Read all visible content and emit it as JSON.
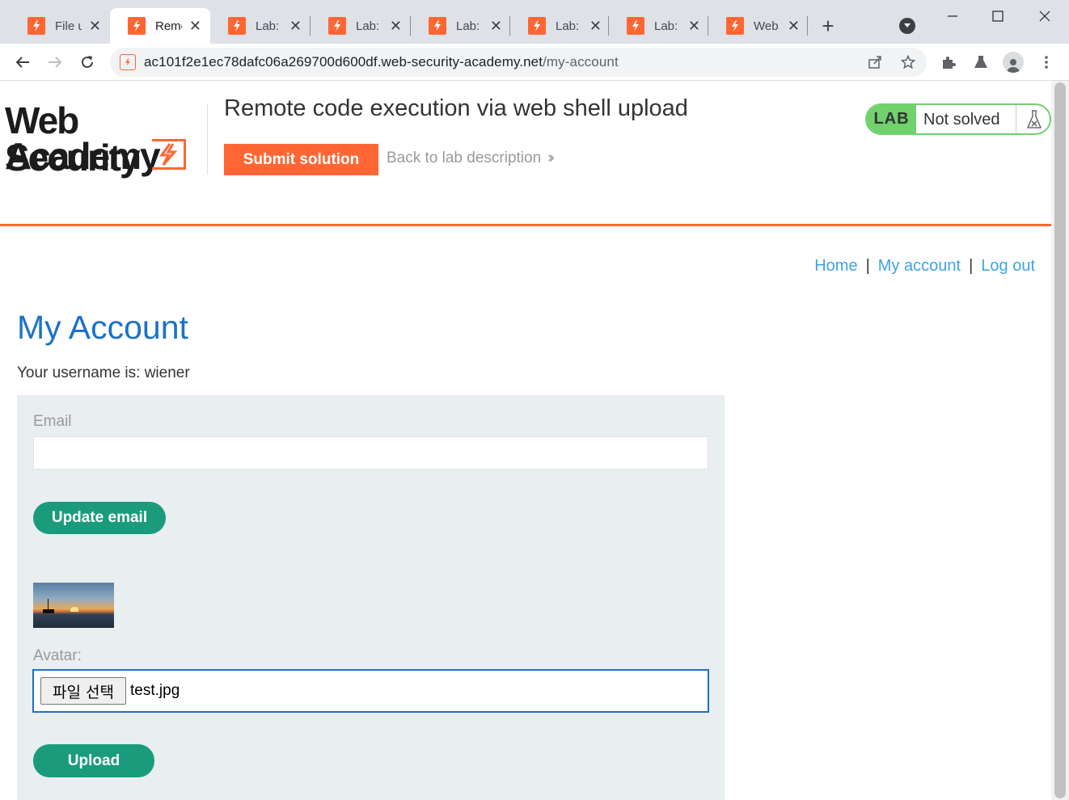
{
  "browser": {
    "tabs": [
      {
        "title": "File up",
        "active": false
      },
      {
        "title": "Remot",
        "active": true
      },
      {
        "title": "Lab: W",
        "active": false
      },
      {
        "title": "Lab: W",
        "active": false
      },
      {
        "title": "Lab: W",
        "active": false
      },
      {
        "title": "Lab: R",
        "active": false
      },
      {
        "title": "Lab: W",
        "active": false
      },
      {
        "title": "Web s",
        "active": false
      }
    ],
    "url_host": "ac101f2e1ec78dafc06a269700d600df.web-security-academy.net",
    "url_path": "/my-account",
    "accent": "#ff6633"
  },
  "lab": {
    "logo_line1": "Web Security",
    "logo_line2": "Academy",
    "title": "Remote code execution via web shell upload",
    "submit_label": "Submit solution",
    "back_label": "Back to lab description",
    "status_badge": "LAB",
    "status_text": "Not solved",
    "status_color": "#70d16d"
  },
  "nav": {
    "home": "Home",
    "my_account": "My account",
    "log_out": "Log out",
    "separator": "|"
  },
  "account": {
    "heading": "My Account",
    "username_text": "Your username is: wiener",
    "email_label": "Email",
    "email_value": "",
    "update_email_label": "Update email",
    "avatar_label": "Avatar:",
    "file_button_label": "파일 선택",
    "file_name": "test.jpg",
    "upload_label": "Upload"
  }
}
